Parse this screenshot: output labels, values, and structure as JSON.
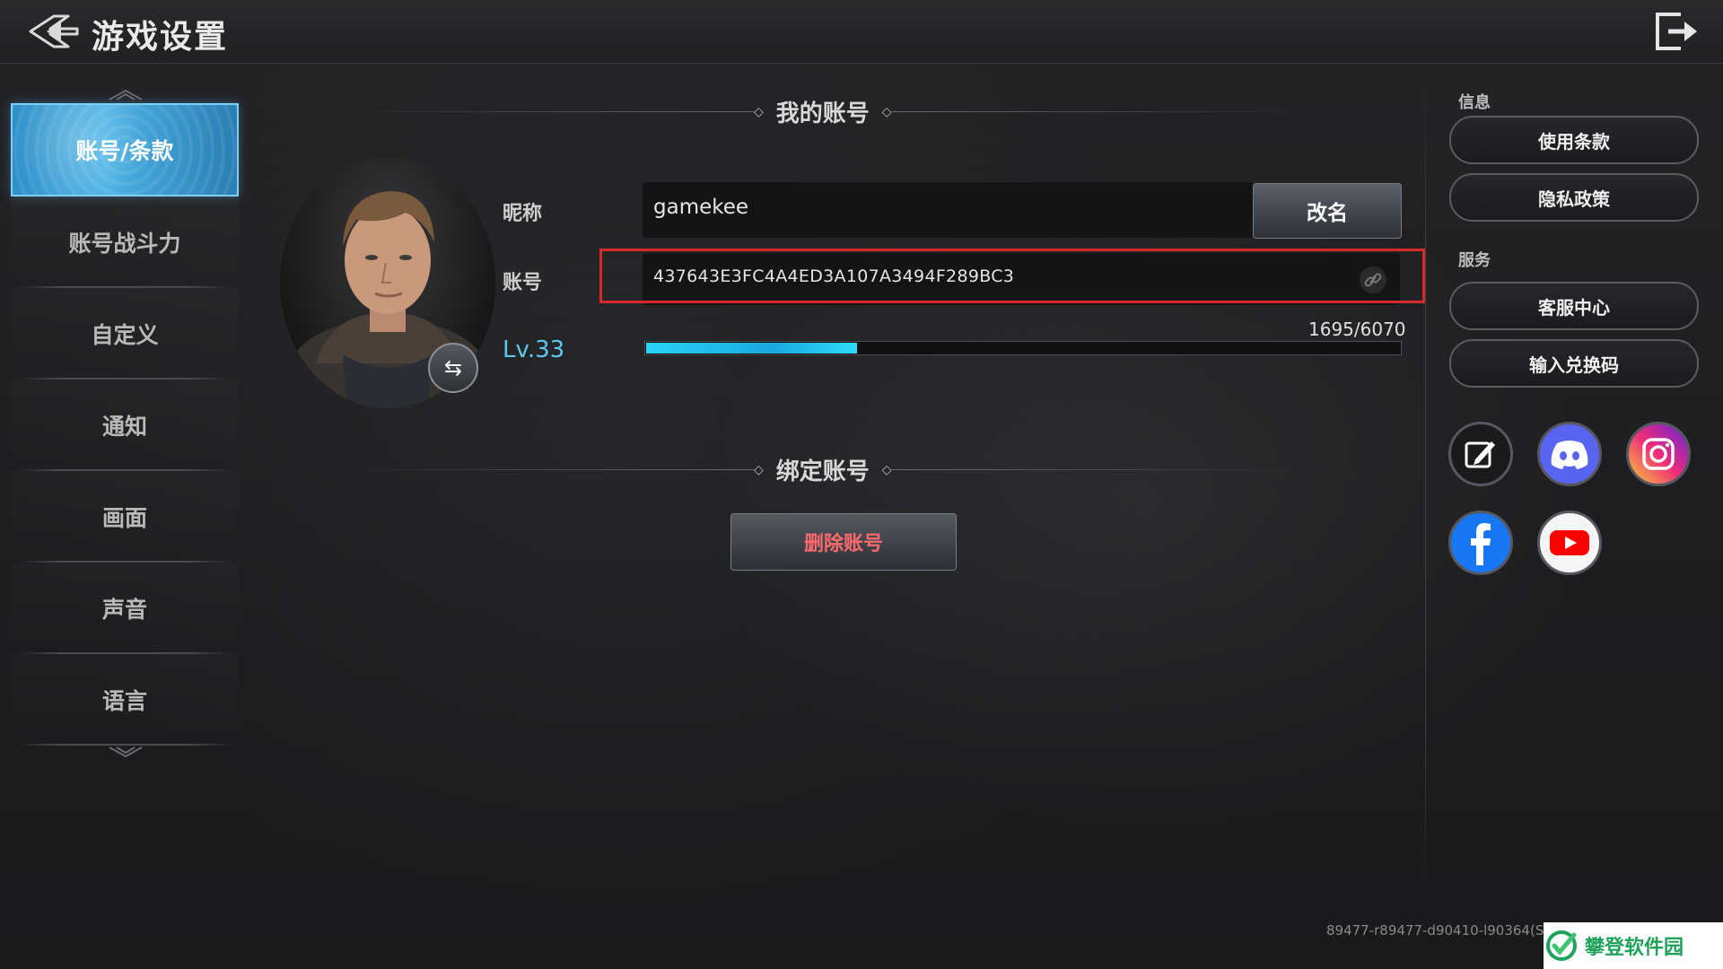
{
  "header": {
    "title": "游戏设置"
  },
  "sidebar": {
    "items": [
      {
        "label": "账号/条款",
        "active": true
      },
      {
        "label": "账号战斗力"
      },
      {
        "label": "自定义"
      },
      {
        "label": "通知"
      },
      {
        "label": "画面"
      },
      {
        "label": "声音"
      },
      {
        "label": "语言"
      }
    ]
  },
  "account": {
    "section_title": "我的账号",
    "nickname_label": "昵称",
    "nickname_value": "gamekee",
    "rename_label": "改名",
    "account_label": "账号",
    "account_value": "437643E3FC4A4ED3A107A3494F289BC3",
    "level": "Lv.33",
    "exp_text": "1695/6070",
    "exp_progress": 0.279
  },
  "bind": {
    "section_title": "绑定账号",
    "delete_label": "删除账号"
  },
  "info": {
    "label": "信息",
    "terms_label": "使用条款",
    "privacy_label": "隐私政策"
  },
  "service": {
    "label": "服务",
    "support_label": "客服中心",
    "redeem_label": "输入兑换码"
  },
  "social": [
    "edit-icon",
    "discord-icon",
    "instagram-icon",
    "facebook-icon",
    "youtube-icon"
  ],
  "version": "89477-r89477-d90410-l90364(S",
  "watermark": "攀登软件园",
  "colors": {
    "accent": "#4cb3e6",
    "level": "#5fc8ef",
    "danger": "#ff6a6a",
    "highlight": "#d62a2a"
  }
}
